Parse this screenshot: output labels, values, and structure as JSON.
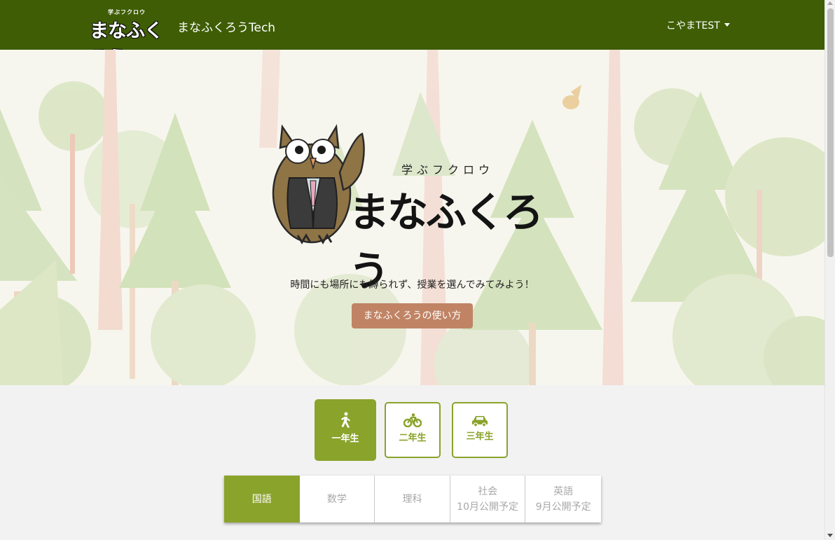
{
  "header": {
    "logo_subtitle": "学ぶフクロウ",
    "logo_text": "まなふくろう",
    "site_name": "まなふくろうTech",
    "user_menu_label": "こやまTEST"
  },
  "hero": {
    "logo_subtitle": "学ぶフクロウ",
    "logo_text": "まなふくろう",
    "tagline": "時間にも場所にも縛られず、授業を選んでみてみよう！",
    "howto_button": "まなふくろうの使い方"
  },
  "grades": [
    {
      "label": "一年生",
      "icon": "walking-person-icon",
      "active": true
    },
    {
      "label": "二年生",
      "icon": "bicycle-icon",
      "active": false
    },
    {
      "label": "三年生",
      "icon": "car-icon",
      "active": false
    }
  ],
  "subjects": [
    {
      "label": "国語",
      "note": "",
      "active": true
    },
    {
      "label": "数学",
      "note": "",
      "active": false
    },
    {
      "label": "理科",
      "note": "",
      "active": false
    },
    {
      "label": "社会",
      "note": "10月公開予定",
      "active": false
    },
    {
      "label": "英語",
      "note": "9月公開予定",
      "active": false
    }
  ],
  "colors": {
    "navbar": "#3e5d05",
    "accent_green": "#8aa32b",
    "howto_button": "#c08465"
  }
}
